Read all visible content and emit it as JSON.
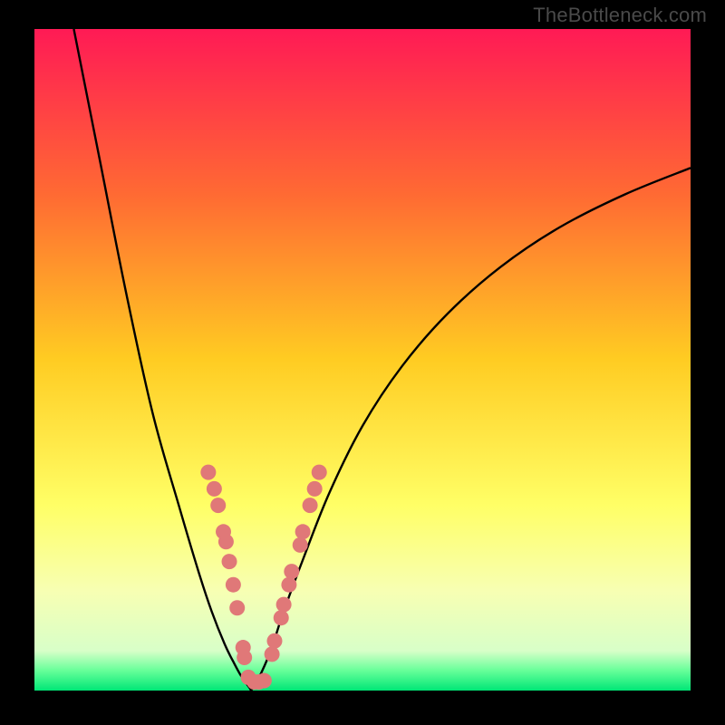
{
  "watermark": "TheBottleneck.com",
  "chart_data": {
    "type": "line",
    "title": "",
    "xlabel": "",
    "ylabel": "",
    "xlim": [
      0,
      100
    ],
    "ylim": [
      0,
      100
    ],
    "background_gradient": {
      "stops": [
        {
          "offset": 0,
          "color": "#ff1a55"
        },
        {
          "offset": 25,
          "color": "#ff6a33"
        },
        {
          "offset": 50,
          "color": "#ffcc22"
        },
        {
          "offset": 72,
          "color": "#ffff66"
        },
        {
          "offset": 85,
          "color": "#f7ffb3"
        },
        {
          "offset": 94,
          "color": "#d8ffc8"
        },
        {
          "offset": 97,
          "color": "#66ff99"
        },
        {
          "offset": 100,
          "color": "#00e676"
        }
      ]
    },
    "series": [
      {
        "name": "left-curve",
        "type": "line",
        "x": [
          6,
          10,
          14,
          18,
          22,
          25,
          27,
          29,
          30.5,
          31.5,
          32.2,
          32.8,
          33.0
        ],
        "y": [
          100,
          80,
          60,
          42,
          28,
          18,
          12,
          7,
          4,
          2.2,
          1.2,
          0.4,
          0.0
        ]
      },
      {
        "name": "right-curve",
        "type": "line",
        "x": [
          33.0,
          34,
          36,
          38,
          41,
          45,
          50,
          56,
          63,
          71,
          80,
          90,
          100
        ],
        "y": [
          0.0,
          1.5,
          6,
          12,
          20,
          30,
          40,
          49,
          57,
          64,
          70,
          75,
          79
        ]
      }
    ],
    "overlay_points": {
      "name": "highlight-dots",
      "color": "#e07878",
      "points": [
        {
          "x": 26.5,
          "y": 33
        },
        {
          "x": 27.4,
          "y": 30.5
        },
        {
          "x": 28.0,
          "y": 28
        },
        {
          "x": 28.8,
          "y": 24
        },
        {
          "x": 29.2,
          "y": 22.5
        },
        {
          "x": 29.7,
          "y": 19.5
        },
        {
          "x": 30.3,
          "y": 16
        },
        {
          "x": 30.9,
          "y": 12.5
        },
        {
          "x": 31.8,
          "y": 6.5
        },
        {
          "x": 32.0,
          "y": 5
        },
        {
          "x": 32.6,
          "y": 2.0
        },
        {
          "x": 33.5,
          "y": 1.3
        },
        {
          "x": 34.2,
          "y": 1.3
        },
        {
          "x": 35.0,
          "y": 1.5
        },
        {
          "x": 36.2,
          "y": 5.5
        },
        {
          "x": 36.6,
          "y": 7.5
        },
        {
          "x": 37.6,
          "y": 11
        },
        {
          "x": 38.0,
          "y": 13
        },
        {
          "x": 38.8,
          "y": 16
        },
        {
          "x": 39.2,
          "y": 18
        },
        {
          "x": 40.5,
          "y": 22
        },
        {
          "x": 40.9,
          "y": 24
        },
        {
          "x": 42.0,
          "y": 28
        },
        {
          "x": 42.7,
          "y": 30.5
        },
        {
          "x": 43.4,
          "y": 33
        }
      ]
    }
  }
}
